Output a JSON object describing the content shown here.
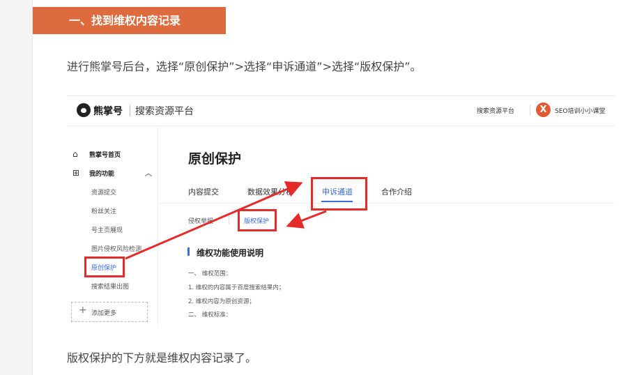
{
  "article": {
    "section_title": "一、找到维权内容记录",
    "para1": "进行熊掌号后台，选择“原创保护”>选择“申诉通道”>选择“版权保护”。",
    "para2": "版权保护的下方就是维权内容记录了。"
  },
  "screenshot": {
    "brand": "熊掌号",
    "platform": "搜索资源平台",
    "top_link": "搜索资源平台",
    "user_avatar": "X",
    "user_name": "SEO培训小小课堂",
    "sidebar": {
      "home": "熊掌号首页",
      "functions": "我的功能",
      "items": [
        "资源提交",
        "粉丝关注",
        "号主页展现",
        "图片侵权风险检测",
        "原创保护",
        "搜索结果出图"
      ],
      "add_more": "添加更多"
    },
    "page_title": "原创保护",
    "tabs": [
      "内容提交",
      "数据效果分析",
      "申诉通道",
      "合作介绍"
    ],
    "sub_tabs": [
      "侵权举报",
      "版权保护"
    ],
    "section_heading": "维权功能使用说明",
    "info_lines": [
      "一、 维权范围：",
      "1. 维权的内容属于百度搜索结果内；",
      "2. 维权内容为原创资源；",
      "二、 维权标准："
    ]
  }
}
